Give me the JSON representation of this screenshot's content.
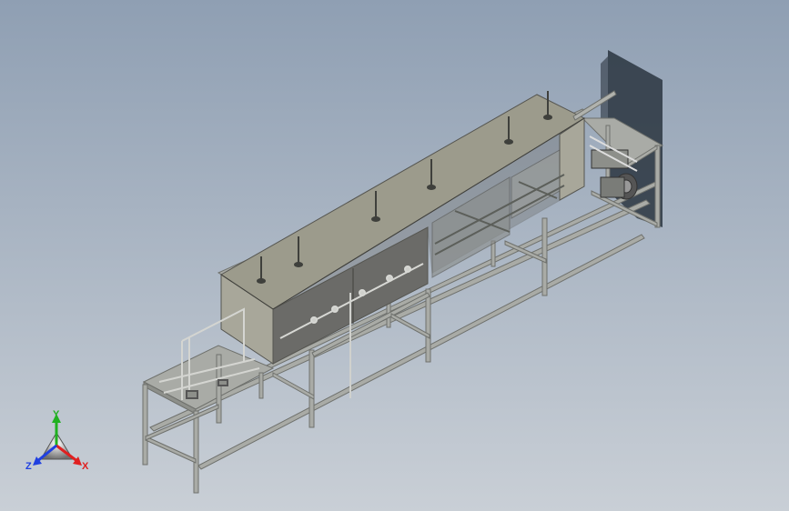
{
  "viewport": {
    "background_top": "#8f9fb3",
    "background_bottom": "#c9cfd6"
  },
  "model": {
    "frame_color": "#a9aba6",
    "frame_dark": "#6f716d",
    "tank_top": "#9c9b8c",
    "tank_front": "#6b6b68",
    "tank_side": "#a8a79a",
    "shadow": "#1f2a33"
  },
  "triad": {
    "x_label": "X",
    "y_label": "Y",
    "z_label": "Z",
    "x_color": "#e02020",
    "y_color": "#20b020",
    "z_color": "#2040e0"
  }
}
